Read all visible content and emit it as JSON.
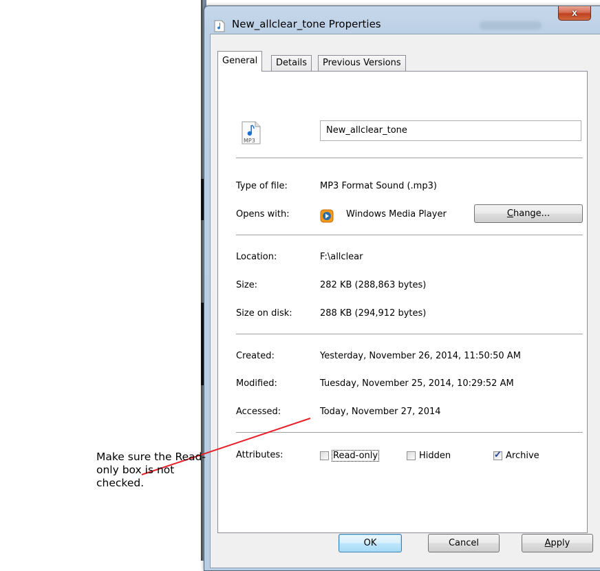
{
  "window": {
    "title": "New_allclear_tone Properties",
    "close_glyph": "x"
  },
  "tabs": [
    {
      "label": "General",
      "active": true
    },
    {
      "label": "Details",
      "active": false
    },
    {
      "label": "Previous Versions",
      "active": false
    }
  ],
  "general": {
    "file_icon_text": "MP3",
    "file_name": "New_allclear_tone",
    "type_label": "Type of file:",
    "type_value": "MP3 Format Sound (.mp3)",
    "opens_label": "Opens with:",
    "opens_value": "Windows Media Player",
    "change_button": "Change...",
    "location_label": "Location:",
    "location_value": "F:\\allclear",
    "size_label": "Size:",
    "size_value": "282 KB (288,863 bytes)",
    "size_on_disk_label": "Size on disk:",
    "size_on_disk_value": "288 KB (294,912 bytes)",
    "created_label": "Created:",
    "created_value": "Yesterday, November 26, 2014, 11:50:50 AM",
    "modified_label": "Modified:",
    "modified_value": "Tuesday, November 25, 2014, 10:29:52 AM",
    "accessed_label": "Accessed:",
    "accessed_value": "Today, November 27, 2014",
    "attributes_label": "Attributes:",
    "attributes": [
      {
        "label": "Read-only",
        "checked": false
      },
      {
        "label": "Hidden",
        "checked": false
      },
      {
        "label": "Archive",
        "checked": true
      }
    ]
  },
  "footer": {
    "ok": "OK",
    "cancel": "Cancel",
    "apply": "Apply"
  },
  "annotation": {
    "text": "Make sure the Read-only box is not checked.",
    "line_color": "#e8202a"
  }
}
